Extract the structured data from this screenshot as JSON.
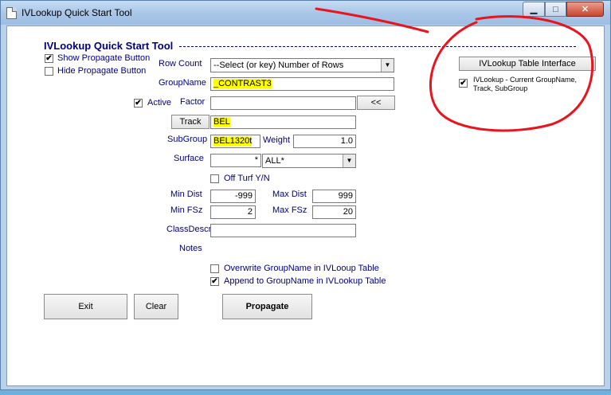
{
  "window": {
    "title": "IVLookup Quick Start Tool"
  },
  "caption_buttons": {
    "minimize": "▁",
    "maximize": "□",
    "close": "✕"
  },
  "form": {
    "header": "IVLookup Quick Start Tool",
    "show_propagate": {
      "label": "Show Propagate Button",
      "checked": "✔"
    },
    "hide_propagate": {
      "label": "Hide Propagate Button",
      "checked": ""
    },
    "row_count": {
      "label": "Row Count",
      "value": "--Select (or key) Number of Rows"
    },
    "group_name": {
      "label": "GroupName",
      "value": "_CONTRAST3"
    },
    "active": {
      "label": "Active",
      "checked": "✔"
    },
    "factor": {
      "label": "Factor",
      "value": "",
      "button": "<<"
    },
    "track": {
      "button": "Track",
      "value": "BEL"
    },
    "subgroup": {
      "label": "SubGroup",
      "value": "BEL1320t"
    },
    "weight": {
      "label": "Weight",
      "value": "1.0"
    },
    "surface": {
      "label": "Surface",
      "value": "*",
      "select": "ALL*"
    },
    "off_turf": {
      "label": "Off Turf Y/N",
      "checked": ""
    },
    "min_dist": {
      "label": "Min Dist",
      "value": "-999"
    },
    "max_dist": {
      "label": "Max Dist",
      "value": "999"
    },
    "min_fsz": {
      "label": "Min FSz",
      "value": "2"
    },
    "max_fsz": {
      "label": "Max FSz",
      "value": "20"
    },
    "class_descr": {
      "label": "ClassDescr",
      "value": ""
    },
    "notes": {
      "label": "Notes"
    },
    "overwrite": {
      "label": "Overwrite GroupName in IVLooup Table",
      "checked": ""
    },
    "append": {
      "label": "Append to GroupName in IVLookup Table",
      "checked": "✔"
    },
    "buttons": {
      "exit": "Exit",
      "clear": "Clear",
      "propagate": "Propagate"
    },
    "ivlookup_interface": {
      "button": "IVLookup Table Interface",
      "checkbox_label": "IVLookup - Current GroupName, Track, SubGroup",
      "checked": "✔"
    }
  },
  "colors": {
    "label": "#000080",
    "highlight": "#ffff00",
    "annotation": "#e8141e"
  }
}
